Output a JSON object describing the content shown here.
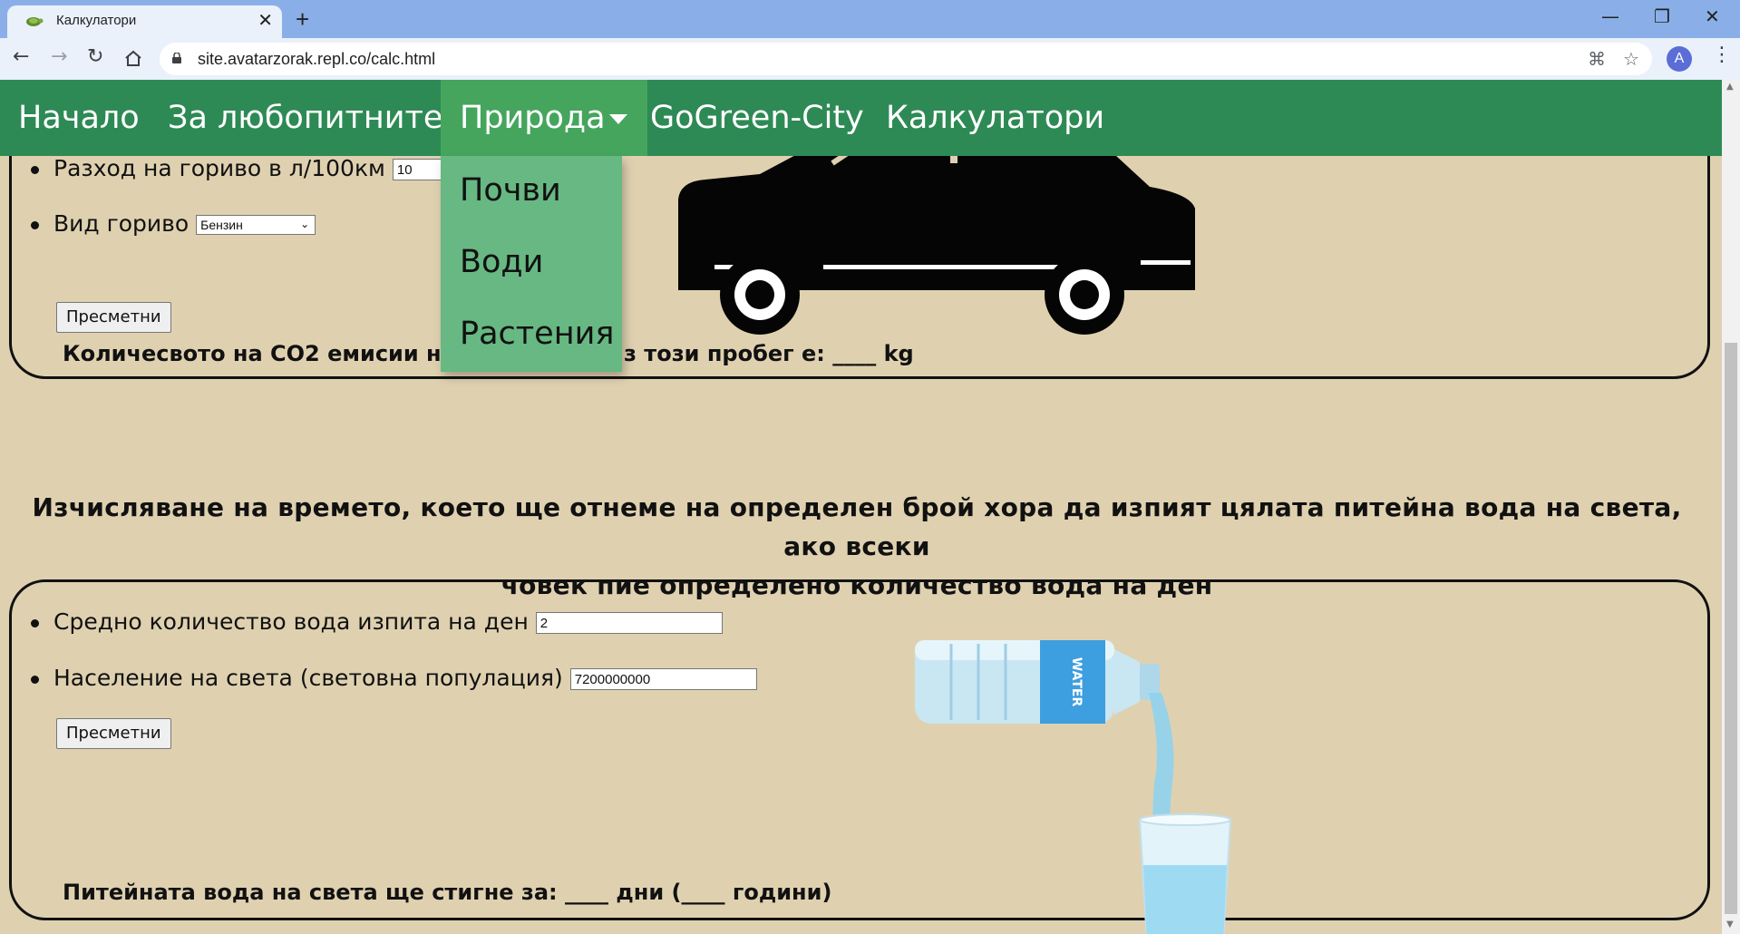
{
  "browser": {
    "tab_title": "Калкулатори",
    "new_tab_symbol": "+",
    "close_symbol": "✕",
    "url": "site.avatarzorak.repl.co/calc.html",
    "avatar_letter": "A",
    "minimize_symbol": "—",
    "restore_symbol": "❐",
    "window_close_symbol": "✕"
  },
  "nav": {
    "items": [
      "Начало",
      "За любопитните",
      "Природа",
      "GoGreen-City",
      "Калкулатори"
    ],
    "dropdown": [
      "Почви",
      "Води",
      "Растения"
    ]
  },
  "car_calc": {
    "fuel_label": "Разход на гориво в л/100км",
    "fuel_value": "10",
    "fuel_type_label": "Вид гориво",
    "fuel_type_selected": "Бензин",
    "button_label": "Пресметни",
    "result_left": "Количесвото на CO2 емисии на в",
    "result_right": "з този пробег е: ____ kg"
  },
  "water_calc": {
    "heading_line1": "Изчисляване на времето, което ще отнеме на определен брой хора да изпият цялата питейна вода на света, ако всеки",
    "heading_line2": "човек пие определено количество вода на ден",
    "daily_label": "Средно количество вода изпита на ден",
    "daily_value": "2",
    "population_label": "Население на света (световна популация)",
    "population_value": "7200000000",
    "button_label": "Пресметни",
    "result": "Питейната вода на света ще стигне за: ____ дни (____ години)",
    "bottle_label": "WATER"
  },
  "colors": {
    "nav_bg": "#2e8a55",
    "nav_active": "#45a55d",
    "dropdown_bg": "#67b882",
    "page_bg": "#dfd1b0"
  }
}
